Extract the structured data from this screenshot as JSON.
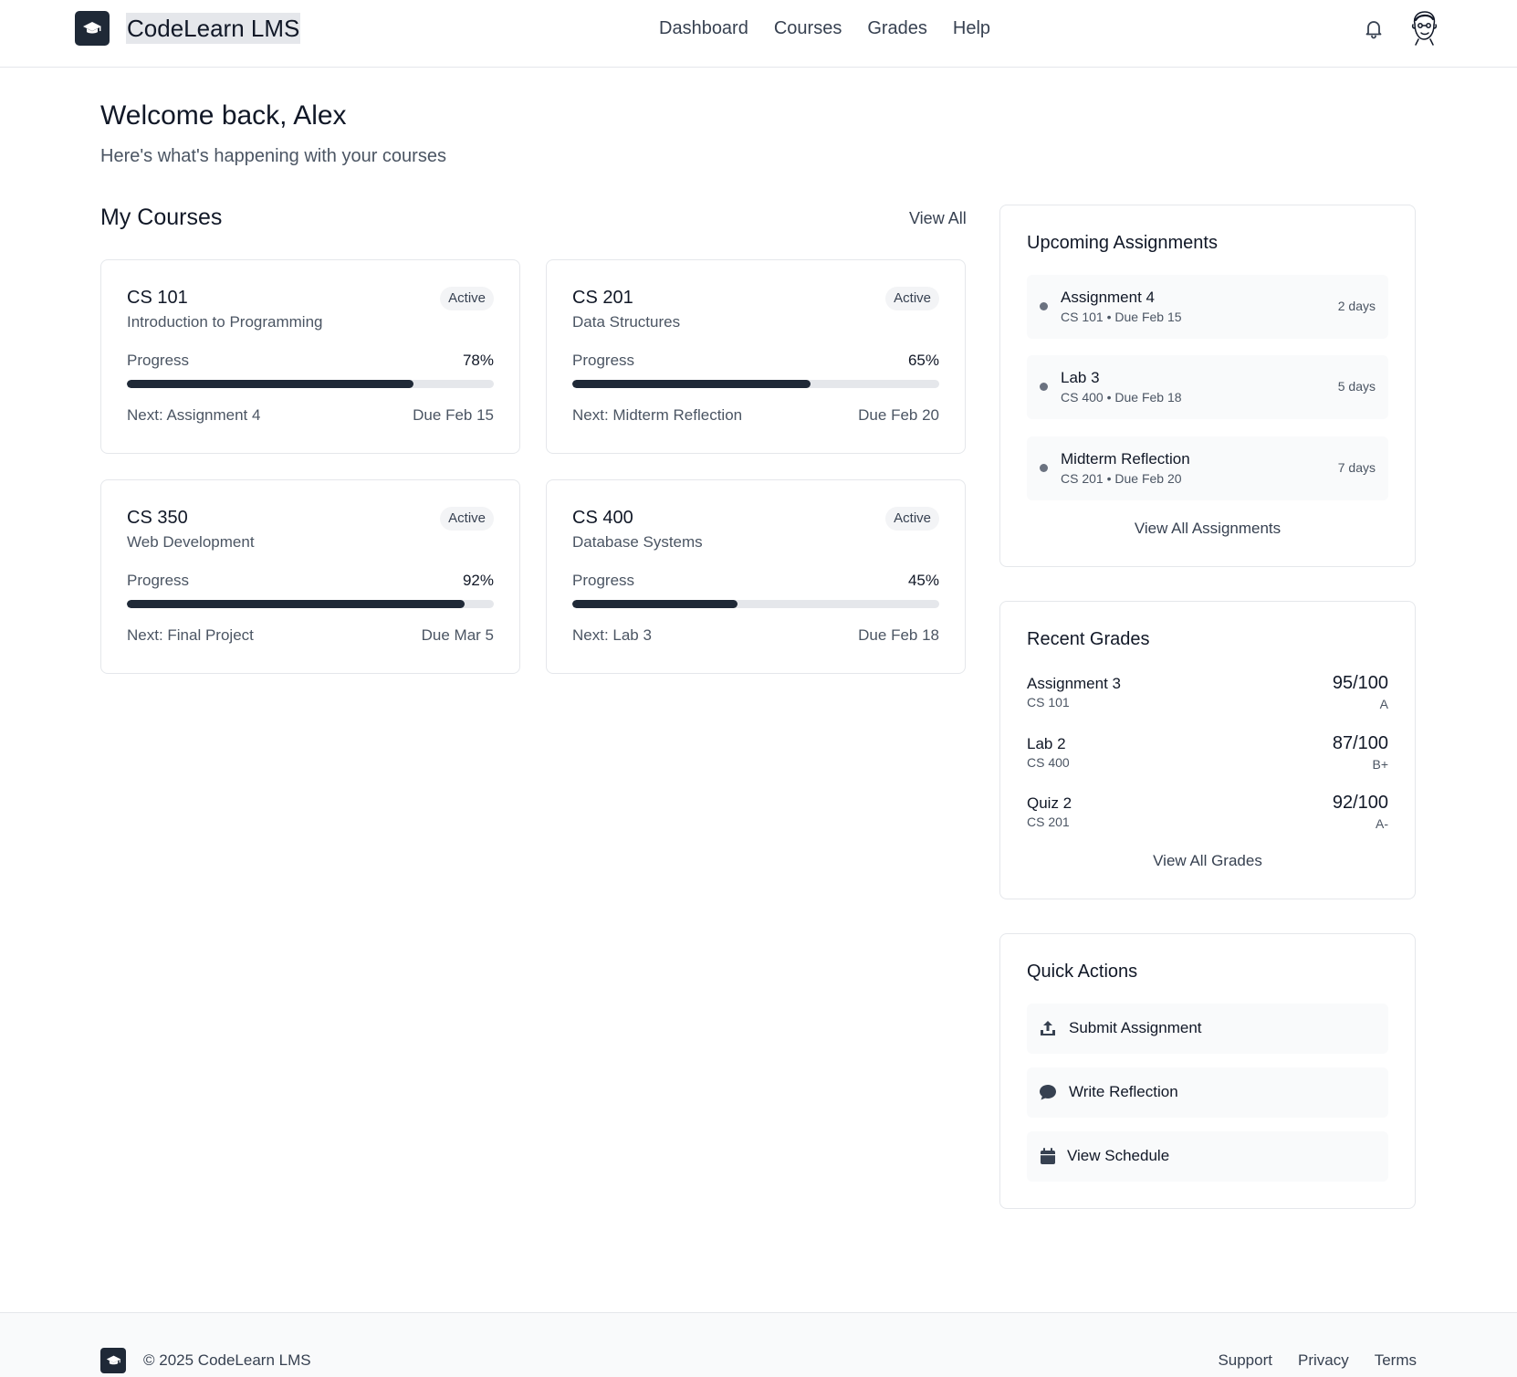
{
  "header": {
    "brand": "CodeLearn LMS",
    "logo_icon": "graduation-cap-icon",
    "nav": [
      "Dashboard",
      "Courses",
      "Grades",
      "Help"
    ],
    "notification_icon": "bell-icon",
    "avatar_icon": "avatar-icon"
  },
  "welcome": {
    "title": "Welcome back, Alex",
    "subtitle": "Here's what's happening with your courses"
  },
  "courses": {
    "title": "My Courses",
    "view_all": "View All",
    "items": [
      {
        "code": "CS 101",
        "name": "Introduction to Programming",
        "status": "Active",
        "progress_label": "Progress",
        "progress_text": "78%",
        "progress": 78,
        "next": "Next: Assignment 4",
        "due": "Due Feb 15"
      },
      {
        "code": "CS 201",
        "name": "Data Structures",
        "status": "Active",
        "progress_label": "Progress",
        "progress_text": "65%",
        "progress": 65,
        "next": "Next: Midterm Reflection",
        "due": "Due Feb 20"
      },
      {
        "code": "CS 350",
        "name": "Web Development",
        "status": "Active",
        "progress_label": "Progress",
        "progress_text": "92%",
        "progress": 92,
        "next": "Next: Final Project",
        "due": "Due Mar 5"
      },
      {
        "code": "CS 400",
        "name": "Database Systems",
        "status": "Active",
        "progress_label": "Progress",
        "progress_text": "45%",
        "progress": 45,
        "next": "Next: Lab 3",
        "due": "Due Feb 18"
      }
    ]
  },
  "assignments": {
    "title": "Upcoming Assignments",
    "items": [
      {
        "title": "Assignment 4",
        "meta": "CS 101 • Due Feb 15",
        "days": "2 days"
      },
      {
        "title": "Lab 3",
        "meta": "CS 400 • Due Feb 18",
        "days": "5 days"
      },
      {
        "title": "Midterm Reflection",
        "meta": "CS 201 • Due Feb 20",
        "days": "7 days"
      }
    ],
    "view_all": "View All Assignments"
  },
  "grades": {
    "title": "Recent Grades",
    "items": [
      {
        "title": "Assignment 3",
        "course": "CS 101",
        "score": "95/100",
        "letter": "A"
      },
      {
        "title": "Lab 2",
        "course": "CS 400",
        "score": "87/100",
        "letter": "B+"
      },
      {
        "title": "Quiz 2",
        "course": "CS 201",
        "score": "92/100",
        "letter": "A-"
      }
    ],
    "view_all": "View All Grades"
  },
  "quick_actions": {
    "title": "Quick Actions",
    "items": [
      {
        "label": "Submit Assignment",
        "icon": "upload-icon"
      },
      {
        "label": "Write Reflection",
        "icon": "chat-bubble-icon"
      },
      {
        "label": "View Schedule",
        "icon": "calendar-icon"
      }
    ]
  },
  "footer": {
    "copyright": "© 2025 CodeLearn LMS",
    "links": [
      "Support",
      "Privacy",
      "Terms"
    ]
  },
  "colors": {
    "primary": "#1f2937",
    "border": "#e5e7eb",
    "muted_text": "#4b5563",
    "surface": "#f9fafb"
  }
}
